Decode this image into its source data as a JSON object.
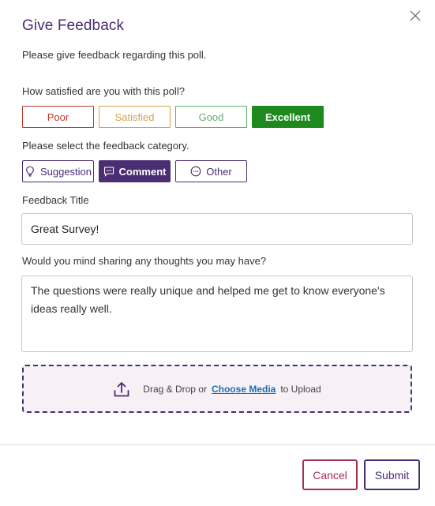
{
  "dialog": {
    "title": "Give Feedback",
    "subtitle": "Please give feedback regarding this poll."
  },
  "satisfaction": {
    "question": "How satisfied are you with this poll?",
    "options": [
      {
        "label": "Poor",
        "color": "#c0392b"
      },
      {
        "label": "Satisfied",
        "color": "#d4a24c"
      },
      {
        "label": "Good",
        "color": "#5fae6e"
      },
      {
        "label": "Excellent",
        "color": "#1e8a1e"
      }
    ],
    "selected": "Excellent"
  },
  "category": {
    "question": "Please select the feedback category.",
    "options": [
      {
        "label": "Suggestion",
        "icon": "lightbulb-icon"
      },
      {
        "label": "Comment",
        "icon": "comment-icon"
      },
      {
        "label": "Other",
        "icon": "more-circle-icon"
      }
    ],
    "selected": "Comment"
  },
  "feedback_title": {
    "label": "Feedback Title",
    "value": "Great Survey!"
  },
  "thoughts": {
    "label": "Would you mind sharing any thoughts you may have?",
    "value": "The questions were really unique and helped me get to know everyone's ideas really well."
  },
  "upload": {
    "prefix": "Drag & Drop or",
    "link": "Choose Media",
    "suffix": "to Upload",
    "icon": "upload-icon"
  },
  "footer": {
    "cancel_label": "Cancel",
    "submit_label": "Submit"
  },
  "colors": {
    "brand": "#4a2d73",
    "cancel": "#a62f52",
    "link": "#1a6fb5"
  }
}
